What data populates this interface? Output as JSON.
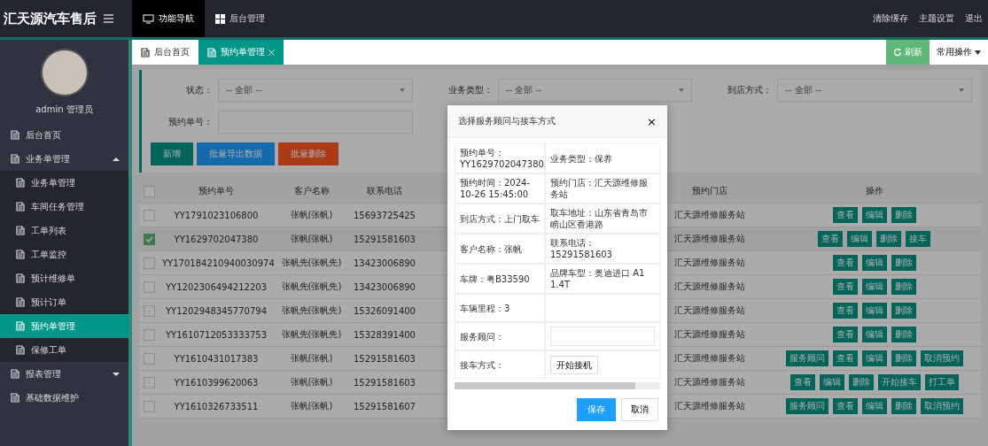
{
  "header": {
    "title": "汇天源汽车售后",
    "nav": [
      {
        "label": "功能导航",
        "selected": true
      },
      {
        "label": "后台管理",
        "selected": false
      }
    ],
    "actions": [
      "清除缓存",
      "主题设置",
      "退出"
    ]
  },
  "sidebar": {
    "user": "admin 管理员",
    "items": [
      {
        "label": "后台首页",
        "selected": false
      },
      {
        "label": "业务单管理",
        "selected": false,
        "expanded": true,
        "children": [
          {
            "label": "业务单管理",
            "selected": false
          },
          {
            "label": "车间任务管理",
            "selected": false
          },
          {
            "label": "工单列表",
            "selected": false
          },
          {
            "label": "工单监控",
            "selected": false
          },
          {
            "label": "预计维修单",
            "selected": false
          },
          {
            "label": "预计订单",
            "selected": false
          },
          {
            "label": "预约单管理",
            "selected": true
          },
          {
            "label": "保修工单",
            "selected": false
          }
        ]
      },
      {
        "label": "报表管理",
        "selected": false,
        "expanded": false
      },
      {
        "label": "基础数据维护",
        "selected": false
      }
    ]
  },
  "tabs": [
    {
      "label": "后台首页",
      "selected": false,
      "closable": false
    },
    {
      "label": "预约单管理",
      "selected": true,
      "closable": true
    }
  ],
  "toolbar": {
    "refresh": "刷新",
    "common": "常用操作"
  },
  "filters": [
    {
      "label": "状态：",
      "kind": "select",
      "value": "-- 全部 --"
    },
    {
      "label": "业务类型：",
      "kind": "select",
      "value": "-- 全部 --"
    },
    {
      "label": "到店方式：",
      "kind": "select",
      "value": "-- 全部 --"
    },
    {
      "label": "预约单号：",
      "kind": "input"
    }
  ],
  "buttons": [
    {
      "label": "新增",
      "kind": "add"
    },
    {
      "label": "批量导出数据",
      "kind": "export"
    },
    {
      "label": "批量删除",
      "kind": "delete"
    }
  ],
  "table": {
    "all_checked": false,
    "columns": [
      "预约单号",
      "客户名称",
      "联系电话",
      "预约门店",
      "操作"
    ],
    "rows": [
      {
        "id": "YY1791023106800",
        "name": "张帆(张帆)",
        "phone": "15693725425",
        "store": "汇天源维修服务站",
        "actions": [
          "查看",
          "编辑",
          "删除"
        ],
        "selected": false
      },
      {
        "id": "YY1629702047380",
        "name": "张帆(张帆)",
        "phone": "15291581603",
        "store": "汇天源维修服务站",
        "actions": [
          "查看",
          "编辑",
          "删除",
          "接车"
        ],
        "selected": true
      },
      {
        "id": "YY170184210940030974",
        "name": "张帆先(张帆先)",
        "phone": "13423006890",
        "store": "汇天源维修服务站",
        "actions": [
          "查看",
          "编辑",
          "删除"
        ],
        "selected": false
      },
      {
        "id": "YY1202306494212203",
        "name": "张帆先(张帆先)",
        "phone": "13423006890",
        "store": "汇天源维修服务站",
        "actions": [
          "查看",
          "编辑",
          "删除"
        ],
        "selected": false
      },
      {
        "id": "YY1202948345770794",
        "name": "张帆先(张帆先)",
        "phone": "15326091400",
        "store": "汇天源维修服务站",
        "actions": [
          "查看",
          "编辑",
          "删除"
        ],
        "selected": false
      },
      {
        "id": "YY1610712053333753",
        "name": "张帆先(张帆先)",
        "phone": "15328391400",
        "store": "汇天源维修服务站",
        "actions": [
          "查看",
          "编辑",
          "删除"
        ],
        "selected": false
      },
      {
        "id": "YY1610431017383",
        "name": "张帆(张帆)",
        "phone": "15291581603",
        "store": "汇天源维修服务站",
        "actions": [
          "服务顾问",
          "查看",
          "编辑",
          "删除",
          "取消预约"
        ],
        "selected": false
      },
      {
        "id": "YY1610399620063",
        "name": "张帆(张帆)",
        "phone": "15291581603",
        "store": "汇天源维修服务站",
        "actions": [
          "查看",
          "编辑",
          "删除",
          "开始接车",
          "打工单"
        ],
        "selected": false
      },
      {
        "id": "YY1610326733511",
        "name": "张帆(张帆)",
        "phone": "15291581607",
        "store": "汇天源维修服务站",
        "actions": [
          "服务顾问",
          "查看",
          "编辑",
          "删除",
          "取消预约"
        ],
        "selected": false
      }
    ]
  },
  "dialog": {
    "title": "选择服务顾问与接车方式",
    "close": "×",
    "cells": [
      [
        "预约单号：YY1629702047380",
        "业务类型：保养"
      ],
      [
        "预约时间：2024-10-26 15:45:00",
        "预约门店：汇天源维修服务站"
      ],
      [
        "到店方式：上门取车",
        "取车地址：山东省青岛市崂山区香港路"
      ],
      [
        "客户名称：张帆",
        "联系电话：15291581603"
      ],
      [
        "车牌：粤B33590",
        "品牌车型：奥迪进口 A1 1.4T"
      ],
      [
        "车辆里程：3"
      ]
    ],
    "advisor_label": "服务顾问：",
    "pickup_label": "接车方式：",
    "pickup_button": "开始接机",
    "save": "保存",
    "cancel": "取消"
  }
}
